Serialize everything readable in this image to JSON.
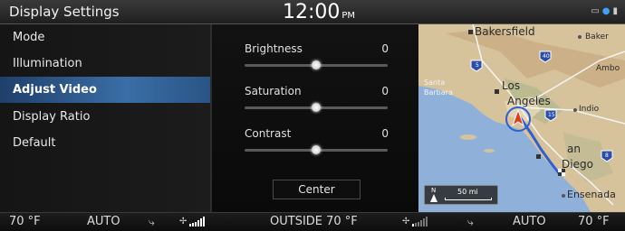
{
  "header": {
    "title": "Display Settings",
    "time": "12:00",
    "ampm": "PM"
  },
  "menu": {
    "items": [
      {
        "label": "Mode",
        "active": false
      },
      {
        "label": "Illumination",
        "active": false
      },
      {
        "label": "Adjust Video",
        "active": true
      },
      {
        "label": "Display Ratio",
        "active": false
      },
      {
        "label": "Default",
        "active": false
      }
    ]
  },
  "adjust": {
    "sliders": [
      {
        "label": "Brightness",
        "value": "0",
        "level": 0.5
      },
      {
        "label": "Saturation",
        "value": "0",
        "level": 0.5
      },
      {
        "label": "Contrast",
        "value": "0",
        "level": 0.5
      }
    ],
    "center_label": "Center"
  },
  "map": {
    "places": {
      "bakersfield": "Bakersfield",
      "baker": "Baker",
      "amboy": "Ambo",
      "santa_barbara_1": "Santa",
      "santa_barbara_2": "Barbara",
      "los": "Los",
      "angeles": "Angeles",
      "indio": "Indio",
      "san": "an",
      "diego": "Diego",
      "ensenada": "Ensenada"
    },
    "shields": [
      "5",
      "40",
      "15",
      "8"
    ],
    "scale": {
      "north": "N",
      "distance": "50 mi"
    },
    "colors": {
      "land": "#d9c8a2",
      "water": "#8fb1d9",
      "route": "#2f5fd0",
      "vehicle": "#e23b1a"
    }
  },
  "climate": {
    "left_temp": "70 °F",
    "left_mode": "AUTO",
    "outside": "OUTSIDE  70 °F",
    "right_mode": "AUTO",
    "right_temp": "70 °F",
    "left_fan_level": 6,
    "right_fan_level": 1,
    "fan_max": 6
  },
  "icons": {
    "battery": "battery-icon",
    "bluetooth": "bluetooth-icon",
    "signal": "signal-icon",
    "airflow": "airflow-icon",
    "fan": "fan-icon"
  }
}
